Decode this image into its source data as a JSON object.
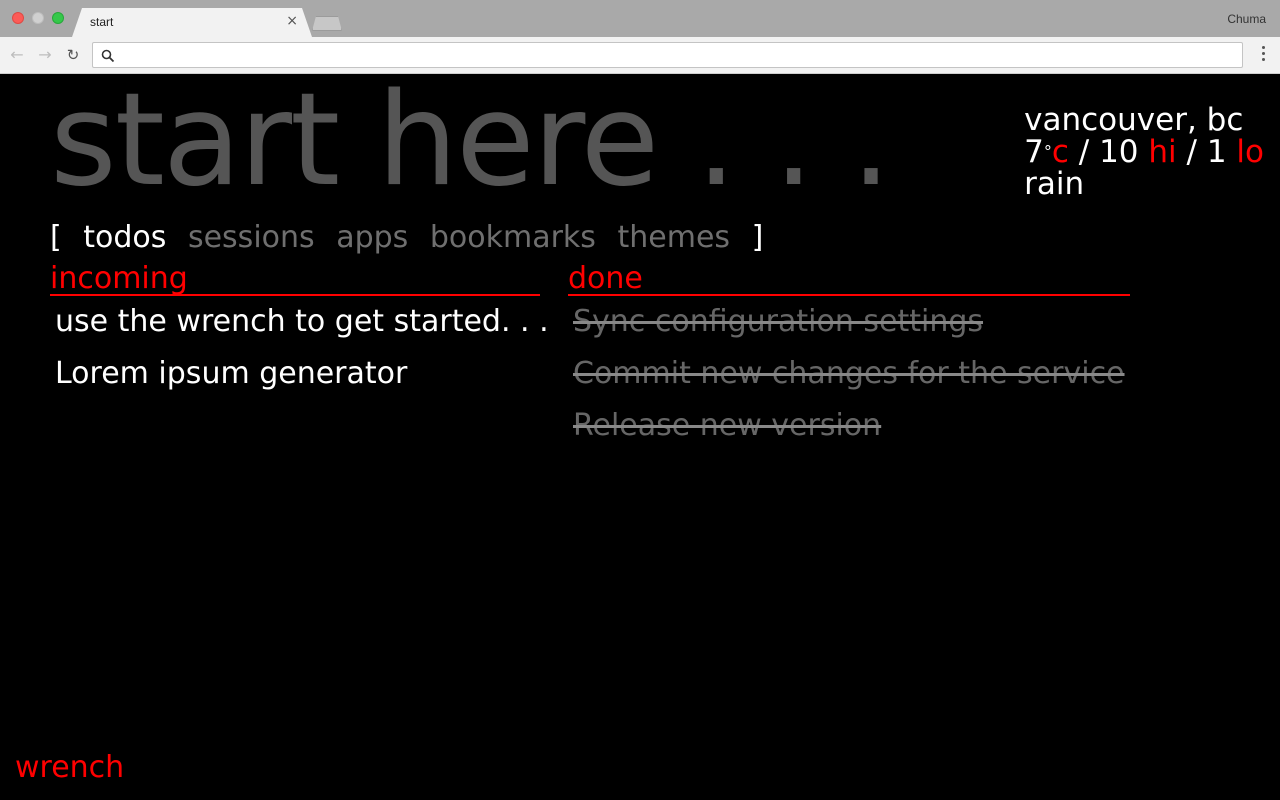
{
  "browser": {
    "tab_title": "start",
    "tab_close": "×",
    "profile_name": "Chuma",
    "address_value": "",
    "address_placeholder": "",
    "nav": {
      "back": "←",
      "forward": "→",
      "reload": "↻"
    }
  },
  "page": {
    "hero_title": "start here . . .",
    "weather": {
      "location": "vancouver, bc",
      "temp": "7",
      "degree": "°",
      "unit": "c",
      "separator1": " / ",
      "hi_value": "10",
      "hi_label": "hi",
      "separator2": " / ",
      "lo_value": "1",
      "lo_label": "lo",
      "condition": "rain"
    },
    "tabs": {
      "open_bracket": "[",
      "close_bracket": "]",
      "items": [
        "todos",
        "sessions",
        "apps",
        "bookmarks",
        "themes"
      ],
      "active": "todos"
    },
    "incoming": {
      "heading": "incoming",
      "items": [
        "use the wrench to get started. . .",
        "Lorem ipsum generator"
      ]
    },
    "done": {
      "heading": "done",
      "items": [
        "Sync configuration settings",
        "Commit new changes for the service",
        "Release new version"
      ]
    },
    "footer_link": "wrench"
  },
  "colors": {
    "accent": "#ff0000",
    "hero_text": "#555555",
    "inactive_tab": "#6f6f6f",
    "done_text": "#666666",
    "background": "#000000"
  }
}
